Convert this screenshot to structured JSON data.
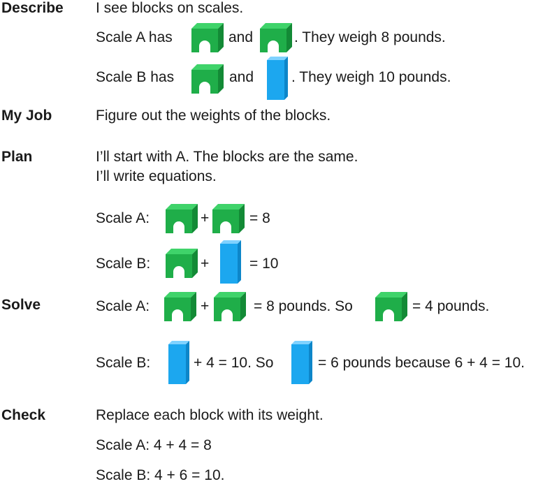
{
  "headings": {
    "describe": "Describe",
    "my_job": "My Job",
    "plan": "Plan",
    "solve": "Solve",
    "check": "Check"
  },
  "describe": {
    "intro": "I see blocks on scales.",
    "line_a": {
      "prefix": "Scale A has",
      "and": "and",
      "suffix": ". They weigh 8 pounds."
    },
    "line_b": {
      "prefix": "Scale B has",
      "and": "and",
      "suffix": ". They weigh 10 pounds."
    }
  },
  "my_job": {
    "text": "Figure out the weights of the blocks."
  },
  "plan": {
    "line1": "I’ll start with A. The blocks are the same.",
    "line2": "I’ll write equations.",
    "eq_a": {
      "label": "Scale A:",
      "plus": "+",
      "result": "= 8"
    },
    "eq_b": {
      "label": "Scale B:",
      "plus": "+",
      "result": "= 10"
    }
  },
  "solve": {
    "line_a": {
      "label": "Scale A:",
      "plus": "+",
      "mid": "= 8 pounds. So",
      "end": "= 4 pounds."
    },
    "line_b": {
      "label": "Scale B:",
      "mid": "+ 4 = 10. So",
      "end": "= 6 pounds because 6 + 4 = 10."
    }
  },
  "check": {
    "intro": "Replace each block with its weight.",
    "line_a": "Scale A:  4 + 4 = 8",
    "line_b": "Scale B:  4 + 6 = 10."
  },
  "colors": {
    "green_block": "#22b04b",
    "blue_block": "#1aa3ea"
  },
  "icons": {
    "arch_block": "green-arch-block-icon",
    "tall_block": "blue-tall-block-icon"
  }
}
